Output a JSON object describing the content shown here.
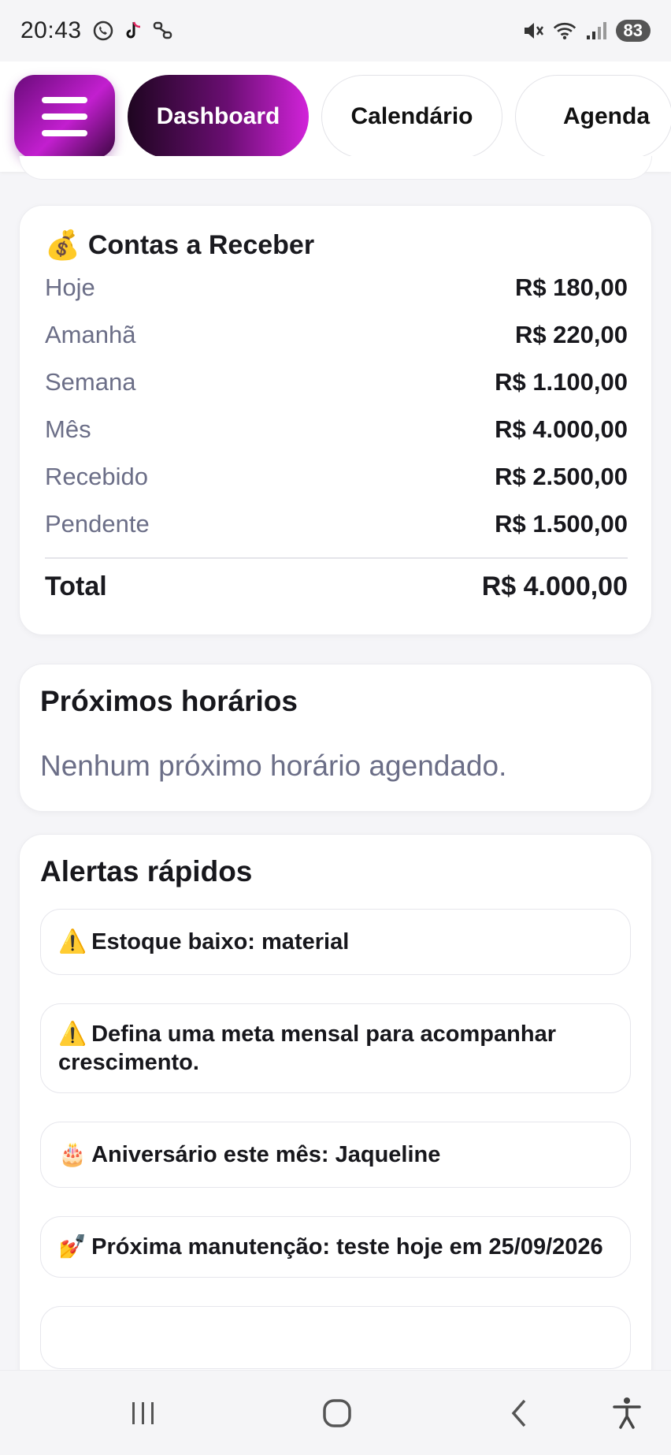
{
  "status_bar": {
    "time": "20:43",
    "battery": "83",
    "left_icons": [
      "whatsapp-icon",
      "tiktok-icon",
      "link-icon"
    ],
    "right_icons": [
      "mute-icon",
      "wifi-icon",
      "signal-icon"
    ]
  },
  "nav": {
    "menu_icon": "hamburger-icon",
    "tabs": [
      {
        "label": "Dashboard",
        "active": true
      },
      {
        "label": "Calendário",
        "active": false
      },
      {
        "label": "Agenda",
        "active": false
      }
    ]
  },
  "receivables": {
    "icon": "💰",
    "title": "Contas a Receber",
    "rows": [
      {
        "label": "Hoje",
        "value": "R$ 180,00"
      },
      {
        "label": "Amanhã",
        "value": "R$ 220,00"
      },
      {
        "label": "Semana",
        "value": "R$ 1.100,00"
      },
      {
        "label": "Mês",
        "value": "R$ 4.000,00"
      },
      {
        "label": "Recebido",
        "value": "R$ 2.500,00"
      },
      {
        "label": "Pendente",
        "value": "R$ 1.500,00"
      }
    ],
    "total_label": "Total",
    "total_value": "R$ 4.000,00"
  },
  "upcoming": {
    "title": "Próximos horários",
    "empty_text": "Nenhum próximo horário agendado."
  },
  "alerts": {
    "title": "Alertas rápidos",
    "items": [
      {
        "emoji": "⚠️",
        "text": "Estoque baixo: material"
      },
      {
        "emoji": "⚠️",
        "text": "Defina uma meta mensal para acompanhar crescimento."
      },
      {
        "emoji": "🎂",
        "text": "Aniversário este mês: Jaqueline"
      },
      {
        "emoji": "💅",
        "text": "Próxima manutenção: teste hoje em 25/09/2026"
      }
    ]
  },
  "bottom_nav": {
    "icons": [
      "recent-apps-icon",
      "home-icon",
      "back-icon",
      "accessibility-icon"
    ]
  },
  "colors": {
    "accent_start": "#6a0b7a",
    "accent_end": "#d223da",
    "muted_text": "#6b6e87"
  }
}
